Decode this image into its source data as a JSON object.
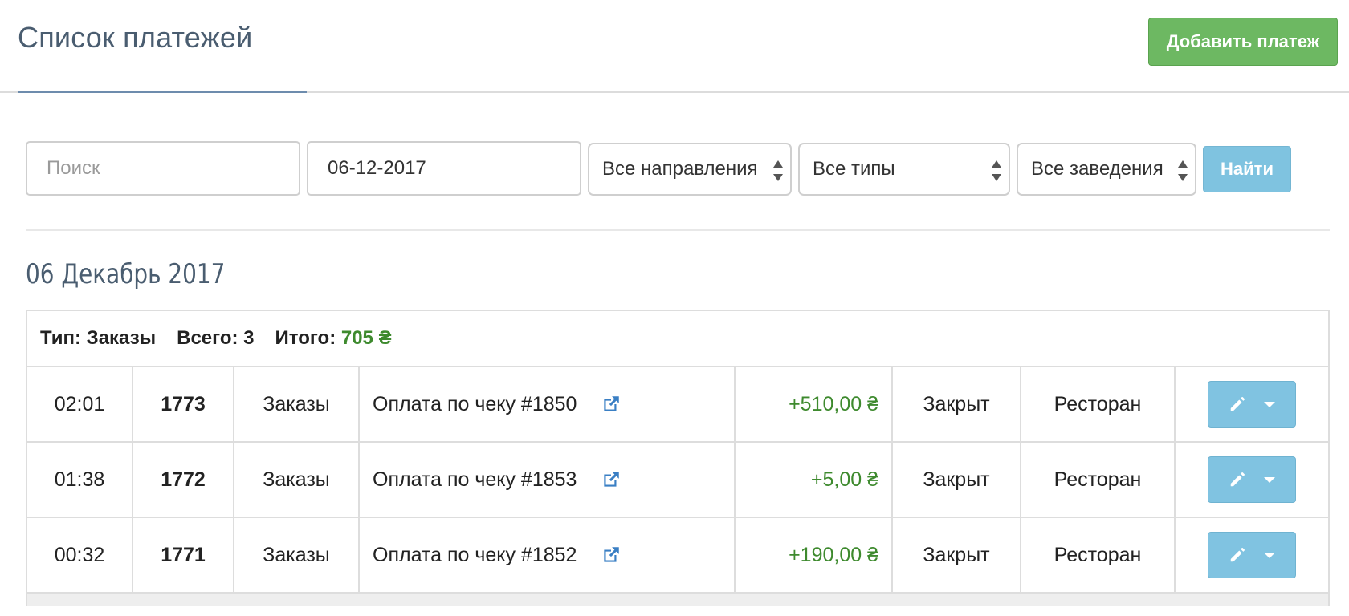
{
  "header": {
    "title": "Список платежей",
    "add_button": "Добавить платеж"
  },
  "filters": {
    "search_placeholder": "Поиск",
    "date_value": "06-12-2017",
    "direction_select": "Все направления",
    "type_select": "Все типы",
    "venue_select": "Все заведения",
    "find_button": "Найти"
  },
  "group": {
    "date_heading": "06 Декабрь 2017",
    "summary": {
      "type": "Тип: Заказы",
      "count": "Всего: 3",
      "total_label": "Итого:",
      "total_value": "705 ₴"
    },
    "rows": [
      {
        "time": "02:01",
        "id": "1773",
        "type": "Заказы",
        "description": "Оплата по чеку #1850",
        "amount": "+510,00 ₴",
        "status": "Закрыт",
        "place": "Ресторан"
      },
      {
        "time": "01:38",
        "id": "1772",
        "type": "Заказы",
        "description": "Оплата по чеку #1853",
        "amount": "+5,00 ₴",
        "status": "Закрыт",
        "place": "Ресторан"
      },
      {
        "time": "00:32",
        "id": "1771",
        "type": "Заказы",
        "description": "Оплата по чеку #1852",
        "amount": "+190,00 ₴",
        "status": "Закрыт",
        "place": "Ресторан"
      }
    ]
  },
  "colors": {
    "accent_green": "#6db862",
    "accent_blue": "#80c3e1",
    "amount_green": "#3e8a2e",
    "link_blue": "#3a7fc4"
  },
  "icons": {
    "external_link": "external-link-icon",
    "edit": "pencil-icon",
    "dropdown": "caret-down-icon"
  }
}
